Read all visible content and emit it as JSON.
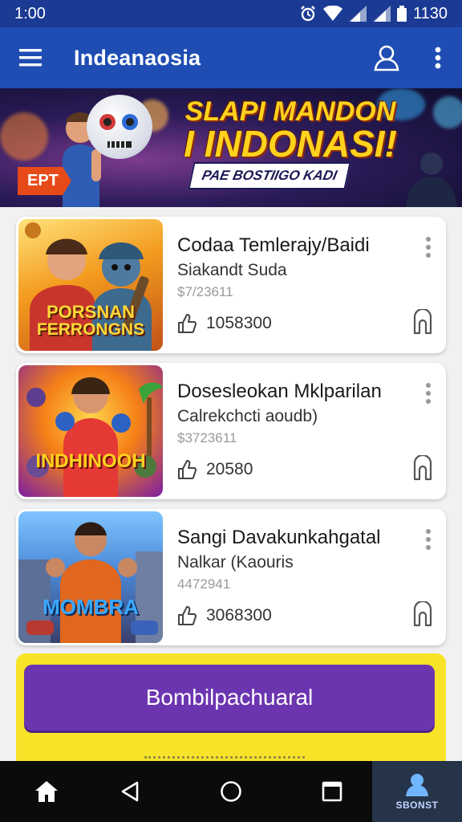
{
  "status": {
    "time": "1:00",
    "battery": "1130"
  },
  "app": {
    "title": "Indeanaosia"
  },
  "banner": {
    "headline_line1": "SLAPI MANDON",
    "headline_line2": "I INDONASI!",
    "tag": "PAE BOSTIIGO KADI",
    "badge": "EPT"
  },
  "games": [
    {
      "title": "Codaa Temlerajy/Baidi",
      "subtitle": "Siakandt Suda",
      "price": "$7/23611",
      "stat": "1058300",
      "thumb_caption_1": "PORSNAN",
      "thumb_caption_2": "FERRONGNS",
      "thumb_color": "#f3b21b"
    },
    {
      "title": "Dosesleokan Mklparilan",
      "subtitle": "Calrekchcti aoudb)",
      "price": "$3723611",
      "stat": "20580",
      "thumb_caption_1": "INDHINOOH",
      "thumb_caption_2": "",
      "thumb_color": "#ffd02a"
    },
    {
      "title": "Sangi Davakunkahgatal",
      "subtitle": "Nalkar (Kaouris",
      "price": "4472941",
      "stat": "3068300",
      "thumb_caption_1": "MOMBRA",
      "thumb_caption_2": "",
      "thumb_color": "#39a6ff"
    }
  ],
  "promo": {
    "button_label": "Bombilpachuaral"
  },
  "nav": {
    "account_label": "SBONST"
  },
  "colors": {
    "app_bar": "#1f4db4",
    "status_bar": "#1a3a93",
    "promo_bg": "#f7e328",
    "promo_button": "#6c35b0"
  },
  "icons": {
    "menu": "hamburger-icon",
    "profile": "user-outline-icon",
    "more": "more-vert-icon",
    "like": "thumb-up-icon",
    "bookmark": "bookmark-icon",
    "home": "home-icon",
    "back": "back-triangle-icon",
    "recents": "recents-square-icon",
    "account": "account-icon"
  }
}
